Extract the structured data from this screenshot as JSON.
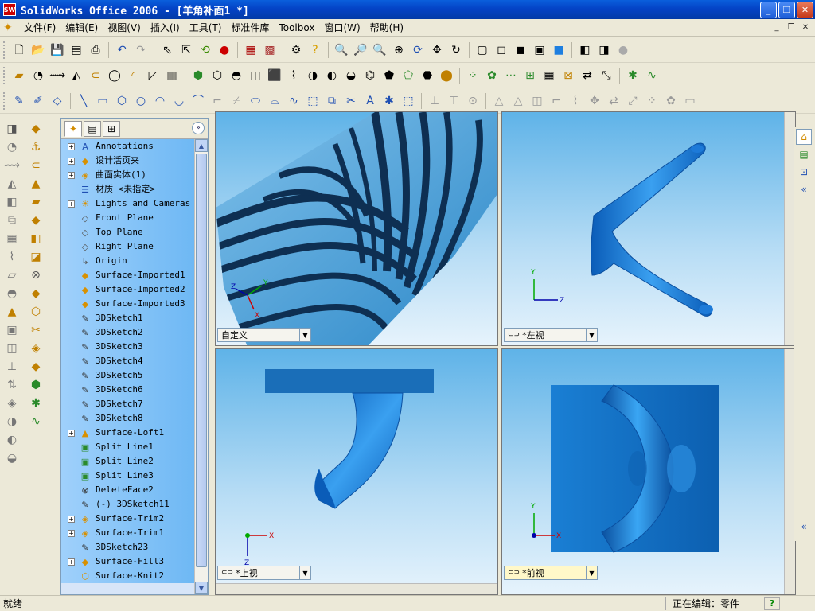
{
  "window": {
    "title": "SolidWorks Office 2006 - [羊角补面1 *]",
    "app_icon": "solidworks-logo",
    "app_icon_text": "SW"
  },
  "menu": [
    {
      "label": "文件(F)"
    },
    {
      "label": "编辑(E)"
    },
    {
      "label": "视图(V)"
    },
    {
      "label": "插入(I)"
    },
    {
      "label": "工具(T)"
    },
    {
      "label": "标准件库"
    },
    {
      "label": "Toolbox"
    },
    {
      "label": "窗口(W)"
    },
    {
      "label": "帮助(H)"
    }
  ],
  "tree": {
    "items": [
      {
        "label": "Annotations",
        "expand": "+",
        "icon": "A"
      },
      {
        "label": "设计活页夹",
        "expand": "+",
        "icon": "◆"
      },
      {
        "label": "曲面实体(1)",
        "expand": "+",
        "icon": "◈"
      },
      {
        "label": "材质 <未指定>",
        "expand": "",
        "icon": "☰"
      },
      {
        "label": "Lights and Cameras",
        "expand": "+",
        "icon": "☀"
      },
      {
        "label": "Front Plane",
        "expand": "",
        "icon": "◇"
      },
      {
        "label": "Top Plane",
        "expand": "",
        "icon": "◇"
      },
      {
        "label": "Right Plane",
        "expand": "",
        "icon": "◇"
      },
      {
        "label": "Origin",
        "expand": "",
        "icon": "↳"
      },
      {
        "label": "Surface-Imported1",
        "expand": "",
        "icon": "◆"
      },
      {
        "label": "Surface-Imported2",
        "expand": "",
        "icon": "◆"
      },
      {
        "label": "Surface-Imported3",
        "expand": "",
        "icon": "◆"
      },
      {
        "label": "3DSketch1",
        "expand": "",
        "icon": "✎"
      },
      {
        "label": "3DSketch2",
        "expand": "",
        "icon": "✎"
      },
      {
        "label": "3DSketch3",
        "expand": "",
        "icon": "✎"
      },
      {
        "label": "3DSketch4",
        "expand": "",
        "icon": "✎"
      },
      {
        "label": "3DSketch5",
        "expand": "",
        "icon": "✎"
      },
      {
        "label": "3DSketch6",
        "expand": "",
        "icon": "✎"
      },
      {
        "label": "3DSketch7",
        "expand": "",
        "icon": "✎"
      },
      {
        "label": "3DSketch8",
        "expand": "",
        "icon": "✎"
      },
      {
        "label": "Surface-Loft1",
        "expand": "+",
        "icon": "▲"
      },
      {
        "label": "Split Line1",
        "expand": "",
        "icon": "▣"
      },
      {
        "label": "Split Line2",
        "expand": "",
        "icon": "▣"
      },
      {
        "label": "Split Line3",
        "expand": "",
        "icon": "▣"
      },
      {
        "label": "DeleteFace2",
        "expand": "",
        "icon": "⊗"
      },
      {
        "label": "(-) 3DSketch11",
        "expand": "",
        "icon": "✎"
      },
      {
        "label": "Surface-Trim2",
        "expand": "+",
        "icon": "◈"
      },
      {
        "label": "Surface-Trim1",
        "expand": "+",
        "icon": "◈"
      },
      {
        "label": "3DSketch23",
        "expand": "",
        "icon": "✎"
      },
      {
        "label": "Surface-Fill3",
        "expand": "+",
        "icon": "◆"
      },
      {
        "label": "Surface-Knit2",
        "expand": "",
        "icon": "⬡"
      }
    ]
  },
  "viewports": {
    "tl": {
      "label": "自定义"
    },
    "tr": {
      "label": "*左视"
    },
    "bl": {
      "label": "*上视"
    },
    "br": {
      "label": "*前视"
    }
  },
  "axes": {
    "x": "X",
    "y": "Y",
    "z": "Z"
  },
  "status": {
    "left": "就绪",
    "mode": "正在编辑：零件",
    "help": "?"
  },
  "colors": {
    "accent": "#0a5fdc",
    "part_blue": "#1e7fe0",
    "tree_bg": "#8ec8f8"
  }
}
